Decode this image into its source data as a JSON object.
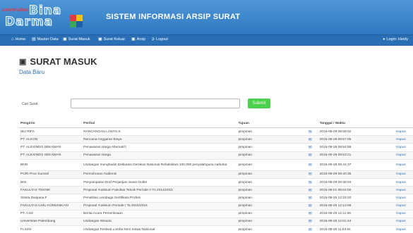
{
  "header": {
    "logo_small": "universitas",
    "logo_word1": "Bina",
    "logo_word2": "Darma",
    "title": "SISTEM INFORMASI ARSIP SURAT"
  },
  "nav": {
    "items": [
      {
        "label": "Home",
        "icon": "home-icon"
      },
      {
        "label": "Master Data",
        "icon": "list-icon"
      },
      {
        "label": "Surat Masuk",
        "icon": "inbox-icon"
      },
      {
        "label": "Surat Keluar",
        "icon": "inbox-icon"
      },
      {
        "label": "Arsip",
        "icon": "inbox-icon"
      },
      {
        "label": "Logout",
        "icon": "logout-icon"
      }
    ],
    "login_label": "Login: Heidy"
  },
  "page": {
    "title": "SURAT MASUK",
    "subtitle": "Data Baru"
  },
  "search": {
    "label": "Cari Surat",
    "value": "",
    "placeholder": "",
    "submit_label": "Submit"
  },
  "table": {
    "headers": {
      "pengirim": "Pengirim",
      "perihal": "Perihal",
      "tujuan": "Tujuan",
      "tanggal": "Tanggal / Waktu"
    },
    "delete_label": "Hapus",
    "rows": [
      {
        "pengirim": "IBU RIFA",
        "perihal": "RANCANGAN LANTAI 6",
        "tujuan": "pimpinan",
        "tanggal": "2015-09-29 09:59:02"
      },
      {
        "pengirim": "PT. ALKON",
        "perihal": "Rencana Anggaran Biaya",
        "tujuan": "pimpinan",
        "tanggal": "2015-09-29 09:57:05"
      },
      {
        "pengirim": "PT. ALEXINDO SEKAWAN",
        "perihal": "Penawaran Harga Alternatif I",
        "tujuan": "pimpinan",
        "tanggal": "2015-09-29 09:54:56"
      },
      {
        "pengirim": "PT. ALEXINDO SEKAWAN",
        "perihal": "Penawaran Harga",
        "tujuan": "pimpinan",
        "tanggal": "2015-09-29 09:53:21"
      },
      {
        "pengirim": "BNN",
        "perihal": "Undangan menghadiri Deklarasi Gerakan Nasional Rehabilitasi 100.000 penyalahguna narkoba",
        "tujuan": "pimpinan",
        "tanggal": "2015-09-29 09:44:37"
      },
      {
        "pengirim": "PGRI Prov Sumsel",
        "perihal": "Permohonan Audiensi",
        "tujuan": "pimpinan",
        "tanggal": "2015-09-29 09:40:35"
      },
      {
        "pengirim": "BNI",
        "perihal": "Penyampaian Draf Perjanjian Sewa Outlet",
        "tujuan": "pimpinan",
        "tanggal": "2015-09-29 09:38:04"
      },
      {
        "pengirim": "FAKULTAS TEKNIK",
        "perihal": "Proposal Yudisium Fakultas Teknik Periode II TA 2014/2015",
        "tujuan": "pimpinan",
        "tanggal": "2015-09-01 08:04:00"
      },
      {
        "pengirim": "Stiinta Dwipana F",
        "perihal": "Penelitian Lembaga Sertifikasi Profesi",
        "tujuan": "pimpinan",
        "tanggal": "2015-08-25 12:15:20"
      },
      {
        "pengirim": "FAKULTAS ILMU KOMUNIKASI",
        "perihal": "Proposal Yudisium Periode I Ta 2015/2016",
        "tujuan": "pimpinan",
        "tanggal": "2015-08-25 12:13:08"
      },
      {
        "pengirim": "PT. CSS",
        "perihal": "Berita Acara Pemeriksaan",
        "tujuan": "pimpinan",
        "tanggal": "2015-08-25 12:11:06"
      },
      {
        "pengirim": "Universitas Palembang",
        "perihal": "Undangan Wisuda",
        "tujuan": "pimpinan",
        "tanggal": "2015-08-25 12:01:44"
      },
      {
        "pengirim": "FLS2N",
        "perihal": "Undangan Festival Lomba Seni Siswa Nasional",
        "tujuan": "pimpinan",
        "tanggal": "2015-08-25 11:53:51"
      }
    ]
  },
  "colors": {
    "header": "#3a84cc",
    "navbar": "#2a6fb5",
    "submit": "#4cd14c",
    "link": "#2d72b8"
  }
}
